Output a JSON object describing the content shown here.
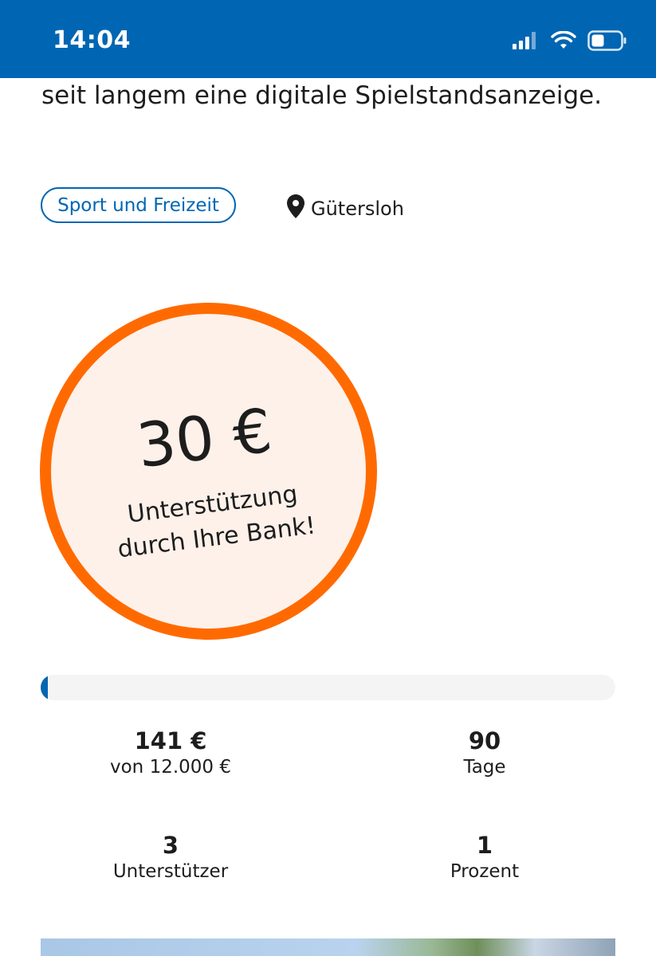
{
  "status_bar": {
    "time": "14:04",
    "icons": [
      "signal-icon",
      "wifi-icon",
      "battery-icon"
    ],
    "background": "#0066b3"
  },
  "description": {
    "visible_line": "seit langem eine digitale Spielstandsanzeige."
  },
  "tags": {
    "category": "Sport und Freizeit",
    "location": "Gütersloh",
    "location_icon": "map-pin-icon"
  },
  "support_badge": {
    "amount": "30 €",
    "line1": "Unterstützung",
    "line2": "durch Ihre Bank!",
    "border_color": "#ff6a00",
    "fill_color": "#fdf1ea"
  },
  "progress": {
    "fraction": 0.0118,
    "color": "#0066b3"
  },
  "stats": {
    "raised": {
      "value": "141 €",
      "label": "von 12.000 €"
    },
    "days": {
      "value": "90",
      "label": "Tage"
    },
    "supporters": {
      "value": "3",
      "label": "Unterstützer"
    },
    "percent": {
      "value": "1",
      "label": "Prozent"
    }
  }
}
